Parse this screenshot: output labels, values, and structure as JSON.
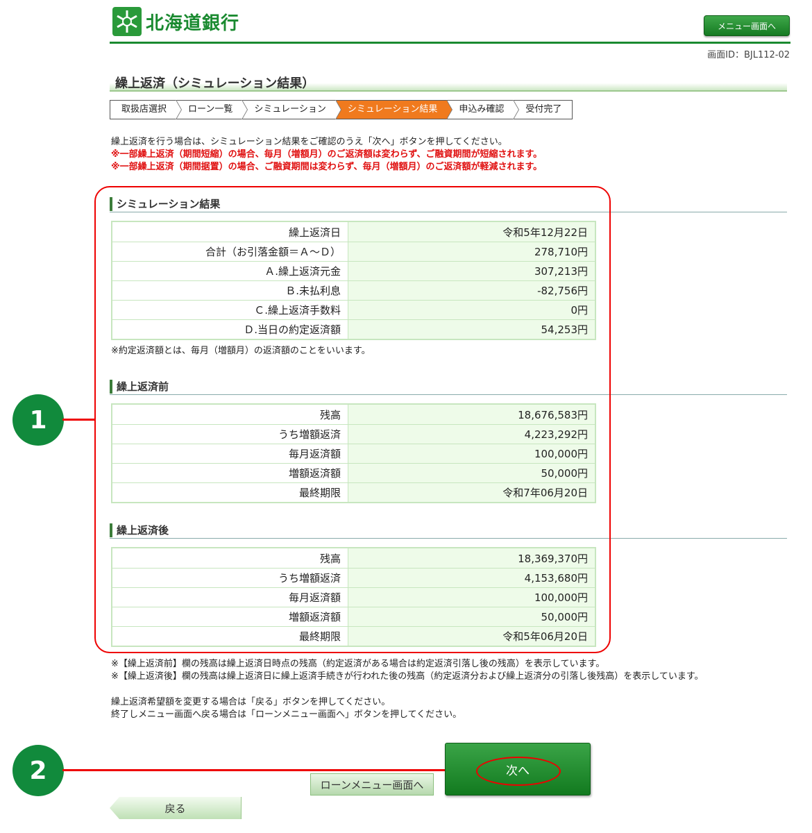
{
  "header": {
    "bank_name": "北海道銀行",
    "menu_button": "メニュー画面へ",
    "screen_id": "画面ID：BJL112-02"
  },
  "page_title": "繰上返済（シミュレーション結果）",
  "steps": [
    "取扱店選択",
    "ローン一覧",
    "シミュレーション",
    "シミュレーション結果",
    "申込み確認",
    "受付完了"
  ],
  "active_step_index": 3,
  "instructions": {
    "line1": "繰上返済を行う場合は、シミュレーション結果をご確認のうえ「次へ」ボタンを押してください。",
    "warn1": "※一部繰上返済（期間短縮）の場合、毎月（増額月）のご返済額は変わらず、ご融資期間が短縮されます。",
    "warn2": "※一部繰上返済（期間据置）の場合、ご融資期間は変わらず、毎月（増額月）のご返済額が軽減されます。"
  },
  "simulation": {
    "heading": "シミュレーション結果",
    "rows": [
      {
        "label": "繰上返済日",
        "value": "令和5年12月22日"
      },
      {
        "label": "合計（お引落金額＝Ａ～Ｄ）",
        "value": "278,710円"
      },
      {
        "label": "Ａ.繰上返済元金",
        "value": "307,213円"
      },
      {
        "label": "Ｂ.未払利息",
        "value": "-82,756円"
      },
      {
        "label": "Ｃ.繰上返済手数料",
        "value": "0円"
      },
      {
        "label": "Ｄ.当日の約定返済額",
        "value": "54,253円"
      }
    ],
    "footnote": "※約定返済額とは、毎月（増額月）の返済額のことをいいます。"
  },
  "before": {
    "heading": "繰上返済前",
    "rows": [
      {
        "label": "残高",
        "value": "18,676,583円"
      },
      {
        "label": "うち増額返済",
        "value": "4,223,292円"
      },
      {
        "label": "毎月返済額",
        "value": "100,000円"
      },
      {
        "label": "増額返済額",
        "value": "50,000円"
      },
      {
        "label": "最終期限",
        "value": "令和7年06月20日"
      }
    ]
  },
  "after": {
    "heading": "繰上返済後",
    "rows": [
      {
        "label": "残高",
        "value": "18,369,370円"
      },
      {
        "label": "うち増額返済",
        "value": "4,153,680円"
      },
      {
        "label": "毎月返済額",
        "value": "100,000円"
      },
      {
        "label": "増額返済額",
        "value": "50,000円"
      },
      {
        "label": "最終期限",
        "value": "令和5年06月20日"
      }
    ]
  },
  "notes": {
    "n1": "※【繰上返済前】欄の残高は繰上返済日時点の残高（約定返済がある場合は約定返済引落し後の残高）を表示しています。",
    "n2": "※【繰上返済後】欄の残高は繰上返済日に繰上返済手続きが行われた後の残高（約定返済分および繰上返済分の引落し後残高）を表示しています。",
    "n3": "繰上返済希望額を変更する場合は「戻る」ボタンを押してください。",
    "n4": "終了しメニュー画面へ戻る場合は「ローンメニュー画面へ」ボタンを押してください。"
  },
  "buttons": {
    "next": "次へ",
    "loan_menu": "ローンメニュー画面へ",
    "back": "戻る"
  },
  "annotations": {
    "badge1": "1",
    "badge2": "2",
    "accent_color": "#e00000",
    "badge_color": "#118a3c"
  }
}
